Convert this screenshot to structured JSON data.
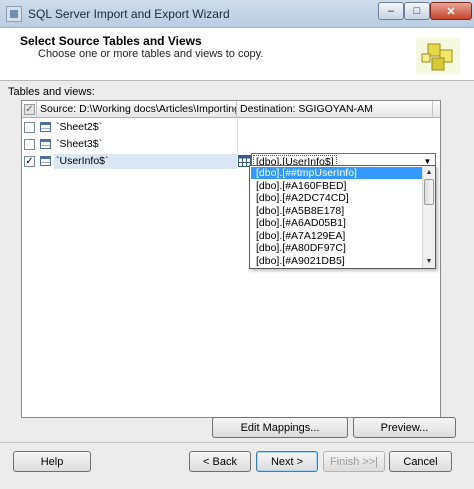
{
  "window": {
    "title": "SQL Server Import and Export Wizard",
    "min_symbol": "–",
    "max_symbol": "□",
    "close_symbol": "✕"
  },
  "header": {
    "title": "Select Source Tables and Views",
    "subtitle": "Choose one or more tables and views to copy."
  },
  "grid": {
    "label": "Tables and views:",
    "columns": {
      "source": "Source: D:\\Working docs\\Articles\\Importing s...",
      "destination": "Destination: SGIGOYAN-AM"
    },
    "rows": [
      {
        "name": "`Sheet2$`",
        "checked": false
      },
      {
        "name": "`Sheet3$`",
        "checked": false
      },
      {
        "name": "`UserInfo$`",
        "checked": true,
        "destination": "[dbo].[UserInfo$]"
      }
    ],
    "checkmark": "✓",
    "dropdown_arrow": "▼"
  },
  "dropdown": {
    "items": [
      "[dbo].[##tmpUserInfo]",
      "[dbo].[#A160FBED]",
      "[dbo].[#A2DC74CD]",
      "[dbo].[#A5B8E178]",
      "[dbo].[#A6AD05B1]",
      "[dbo].[#A7A129EA]",
      "[dbo].[#A80DF97C]",
      "[dbo].[#A9021DB5]"
    ],
    "highlighted_index": 0,
    "scroll_up": "▲",
    "scroll_down": "▼"
  },
  "buttons": {
    "edit_mappings": "Edit Mappings...",
    "preview": "Preview...",
    "help": "Help",
    "back": "< Back",
    "next": "Next >",
    "finish": "Finish >>|",
    "cancel": "Cancel"
  }
}
